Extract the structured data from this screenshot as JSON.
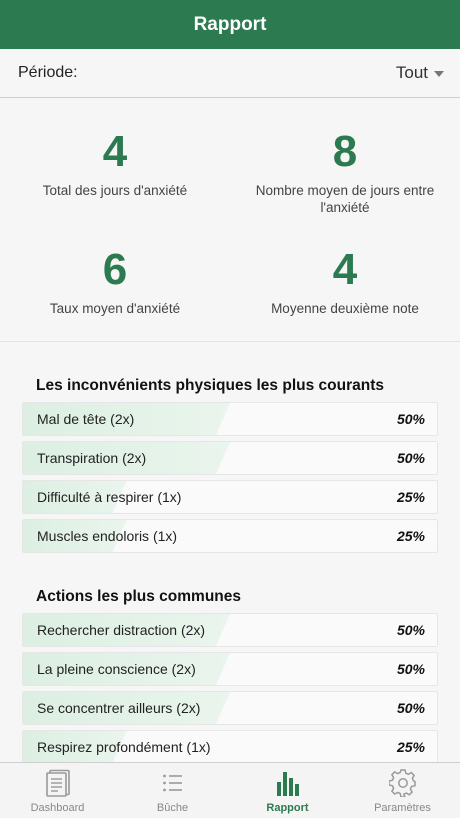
{
  "header": {
    "title": "Rapport"
  },
  "period": {
    "label": "Période:",
    "value": "Tout"
  },
  "stats": [
    {
      "value": "4",
      "label": "Total des jours d'anxiété"
    },
    {
      "value": "8",
      "label": "Nombre moyen de jours entre l'anxiété"
    },
    {
      "value": "6",
      "label": "Taux moyen d'anxiété"
    },
    {
      "value": "4",
      "label": "Moyenne deuxième note"
    }
  ],
  "physical": {
    "title": "Les inconvénients physiques les plus courants",
    "items": [
      {
        "label": "Mal de tête (2x)",
        "percent": "50%",
        "fraction": 0.5
      },
      {
        "label": "Transpiration (2x)",
        "percent": "50%",
        "fraction": 0.5
      },
      {
        "label": "Difficulté à respirer (1x)",
        "percent": "25%",
        "fraction": 0.25
      },
      {
        "label": "Muscles endoloris (1x)",
        "percent": "25%",
        "fraction": 0.25
      }
    ]
  },
  "actions": {
    "title": "Actions les plus communes",
    "items": [
      {
        "label": "Rechercher distraction (2x)",
        "percent": "50%",
        "fraction": 0.5
      },
      {
        "label": "La pleine conscience (2x)",
        "percent": "50%",
        "fraction": 0.5
      },
      {
        "label": "Se concentrer ailleurs (2x)",
        "percent": "50%",
        "fraction": 0.5
      },
      {
        "label": "Respirez profondément (1x)",
        "percent": "25%",
        "fraction": 0.25
      }
    ]
  },
  "tabs": [
    {
      "label": "Dashboard",
      "icon": "dashboard-icon",
      "active": false
    },
    {
      "label": "Bûche",
      "icon": "list-icon",
      "active": false
    },
    {
      "label": "Rapport",
      "icon": "bar-chart-icon",
      "active": true
    },
    {
      "label": "Paramètres",
      "icon": "gear-icon",
      "active": false
    }
  ],
  "colors": {
    "brand": "#2c7a4f",
    "bar_fill": "#dcefe2",
    "inactive": "#888888"
  }
}
